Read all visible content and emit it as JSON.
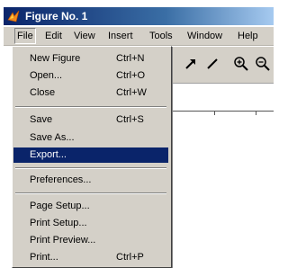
{
  "window": {
    "title": "Figure No. 1"
  },
  "menubar": {
    "items": [
      {
        "label": "File"
      },
      {
        "label": "Edit"
      },
      {
        "label": "View"
      },
      {
        "label": "Insert"
      },
      {
        "label": "Tools"
      },
      {
        "label": "Window"
      },
      {
        "label": "Help"
      }
    ]
  },
  "file_menu": {
    "items": [
      {
        "label": "New Figure",
        "shortcut": "Ctrl+N"
      },
      {
        "label": "Open...",
        "shortcut": "Ctrl+O"
      },
      {
        "label": "Close",
        "shortcut": "Ctrl+W"
      },
      {
        "label": "Save",
        "shortcut": "Ctrl+S"
      },
      {
        "label": "Save As..."
      },
      {
        "label": "Export..."
      },
      {
        "label": "Preferences..."
      },
      {
        "label": "Page Setup..."
      },
      {
        "label": "Print Setup..."
      },
      {
        "label": "Print Preview..."
      },
      {
        "label": "Print...",
        "shortcut": "Ctrl+P"
      }
    ],
    "selected_label": "Export..."
  },
  "toolbar": {
    "tools": [
      "arrow-icon",
      "line-icon",
      "zoom-in-icon",
      "zoom-out-icon"
    ]
  },
  "colors": {
    "selection": "#0a246a",
    "menu_bg": "#d4d0c8",
    "title_gradient_start": "#0a246a",
    "title_gradient_end": "#a6caf0"
  }
}
